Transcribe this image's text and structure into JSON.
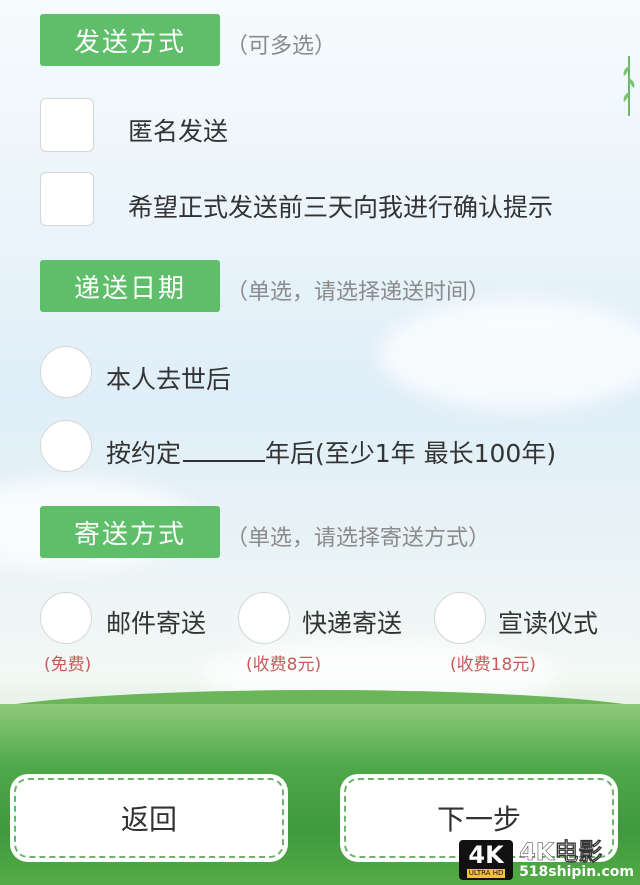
{
  "colors": {
    "tag_green": "#5fbe6a",
    "fee_red": "#c85a5a",
    "hint_gray": "#8b8b8b"
  },
  "send_method": {
    "tag": "发送方式",
    "hint": "（可多选）",
    "options": [
      "匿名发送",
      "希望正式发送前三天向我进行确认提示"
    ]
  },
  "delivery_date": {
    "tag": "递送日期",
    "hint": "（单选，请选择递送时间）",
    "option1": "本人去世后",
    "option2_prefix": "按约定",
    "option2_suffix": "年后(至少1年 最长100年)"
  },
  "mail_method": {
    "tag": "寄送方式",
    "hint": "（单选，请选择寄送方式）",
    "options": [
      {
        "label": "邮件寄送",
        "fee": "(免费)"
      },
      {
        "label": "快递寄送",
        "fee": "(收费8元)"
      },
      {
        "label": "宣读仪式",
        "fee": "(收费18元)"
      }
    ]
  },
  "buttons": {
    "back": "返回",
    "next": "下一步"
  },
  "watermark": {
    "badge": "4K",
    "badge_sub": "ULTRA HD",
    "title": "4K电影",
    "site": "518shipin.com"
  }
}
